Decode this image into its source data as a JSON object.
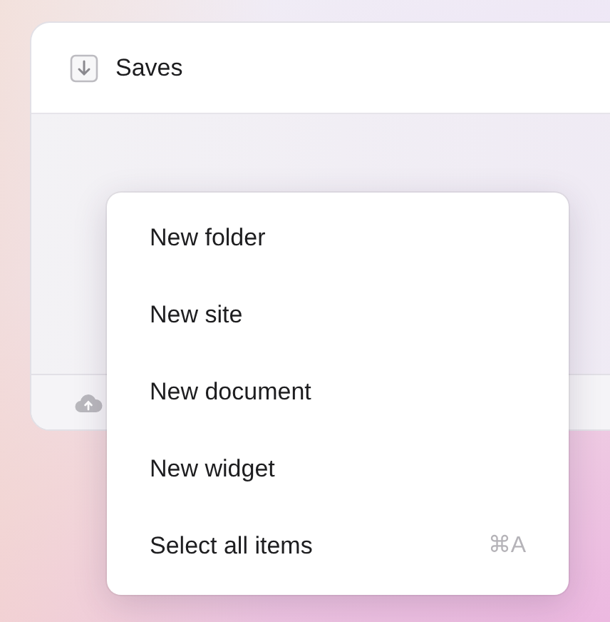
{
  "window": {
    "title": "Saves"
  },
  "menu": {
    "items": [
      {
        "label": "New folder"
      },
      {
        "label": "New site"
      },
      {
        "label": "New document"
      },
      {
        "label": "New widget"
      },
      {
        "label": "Select all items",
        "shortcut": "⌘A"
      }
    ]
  }
}
